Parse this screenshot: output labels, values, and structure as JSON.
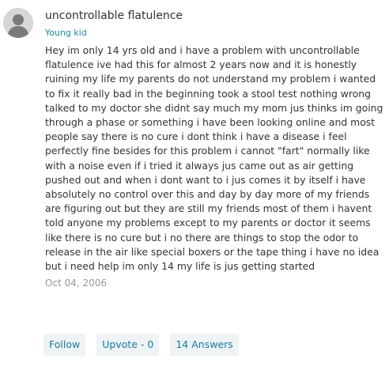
{
  "post": {
    "title": "uncontrollable flatulence",
    "author": "Young kid",
    "body": "Hey im only 14 yrs old and i have a problem with uncontrollable flatulence ive had this for almost 2 years now and it is honestly ruining my life my parents do not understand my problem i wanted to fix it really bad in the beginning took a stool test nothing wrong talked to my doctor she didnt say much my mom jus thinks im going through a phase or something i have been looking online and most people say there is no cure i dont think i have a disease i feel perfectly fine besides for this problem i cannot \"fart\" normally like with a noise even if i tried it always jus came out as air getting pushed out and when i dont want to i jus comes it by itself i have absolutely no control over this and day by day more of my friends are figuring out but they are still my friends most of them i havent told anyone my problems except to my parents or doctor it seems like there is no cure but i no there are things to stop the odor to release in the air like special boxers or the tape thing i have no idea but i need help im only 14 my life is jus getting started",
    "date": "Oct 04, 2006"
  },
  "actions": {
    "follow_label": "Follow",
    "upvote_label": "Upvote - 0",
    "answers_label": "14 Answers"
  },
  "icons": {
    "avatar": "user-silhouette-icon"
  },
  "colors": {
    "author": "#1a8a9a",
    "action_text": "#1a7a9e",
    "action_bg": "#eef3f6",
    "date": "#999999"
  }
}
